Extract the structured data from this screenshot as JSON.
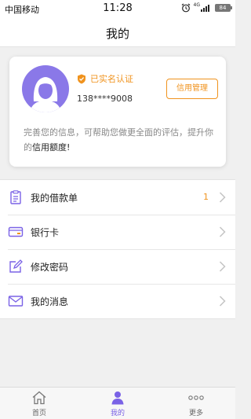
{
  "status_bar": {
    "carrier": "中国移动",
    "time": "11:28",
    "network": "4G",
    "battery": "84"
  },
  "header": {
    "title": "我的"
  },
  "profile": {
    "verified_text": "已实名认证",
    "phone": "138****9008",
    "credit_button": "信用管理",
    "description_prefix": "完善您的信息，可帮助您做更全面的评估，提升你的",
    "description_highlight": "信用额度!"
  },
  "menu": {
    "items": [
      {
        "label": "我的借款单",
        "icon": "clipboard-icon",
        "badge": "1"
      },
      {
        "label": "银行卡",
        "icon": "card-icon"
      },
      {
        "label": "修改密码",
        "icon": "edit-icon"
      },
      {
        "label": "我的消息",
        "icon": "mail-icon"
      }
    ]
  },
  "tabbar": {
    "tabs": [
      {
        "label": "首页",
        "icon": "home-icon"
      },
      {
        "label": "我的",
        "icon": "user-icon",
        "active": true
      },
      {
        "label": "更多",
        "icon": "more-icon"
      }
    ]
  },
  "colors": {
    "accent": "#7a62e6",
    "avatar_bg": "#8a78e8",
    "orange": "#f0931e",
    "background": "#f0f0f0"
  }
}
